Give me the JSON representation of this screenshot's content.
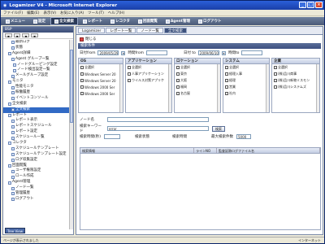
{
  "window": {
    "title": "Logamizer V4 - Microsoft Internet Explorer"
  },
  "menu": [
    "ファイル(F)",
    "編集(E)",
    "表示(V)",
    "お気に入り(A)",
    "ツール(T)",
    "ヘルプ(H)"
  ],
  "appbar": [
    "メニュー",
    "設定",
    "全文検索",
    "レポート",
    "レコクタ",
    "回面閲覧",
    "Agent管理",
    "ログアウト"
  ],
  "side": {
    "header": "BSP",
    "toolbar": [
      "",
      "",
      "",
      ""
    ],
    "tree": [
      "最新ログ",
      "状態",
      "Agent詳細",
      "Agent グループ一覧",
      "ノードグルーピング設定",
      "ノード検出設定一覧",
      "メールグループ設定",
      "モニタ",
      "性能モニタ",
      "稼働履歴",
      "イベントコンソール",
      "全文検索",
      "全文検索",
      "レポート",
      "レポート表示",
      "レポートスケジュール",
      "レポート設定",
      "スケジュール一覧",
      "コレクタ",
      "スケジュールテンプレート",
      "スケジュールテンプレート設定",
      "ログ収集設定",
      "回面閲覧",
      "ユーザ権限設定",
      "ロール作成",
      "Agent管理",
      "ノード一覧",
      "管理履歴",
      "ログアウト"
    ],
    "selected": 12,
    "tree_view": "Tree View"
  },
  "tabs": [
    "Logamizer",
    "レポート一覧",
    "ノード一覧",
    "全文検索"
  ],
  "close_label": "閉じる",
  "search": {
    "section_title": "検索条件",
    "from_label": "日付from",
    "from_date": "2009/05/29",
    "time_from_label": "時間from",
    "time_from": "",
    "to_label": "日付 to",
    "to_date": "2009/06/10",
    "time_to_label": "時間to",
    "time_to": ""
  },
  "boxes": [
    {
      "title": "OS",
      "items": [
        "全選択",
        "Windows Server 20",
        "Windows Server 20",
        "Windows 2000 Ser",
        "Windows 2000 Ser"
      ]
    },
    {
      "title": "アプリケーション",
      "items": [
        "全選択",
        "人事アプリケーション",
        "ウイルス対策アプリケ"
      ]
    },
    {
      "title": "ロケーション",
      "items": [
        "全選択",
        "東京",
        "大阪",
        "福岡",
        "名古屋"
      ]
    },
    {
      "title": "システム",
      "items": [
        "全選択",
        "経理入事",
        "経理",
        "営業",
        "社内"
      ]
    },
    {
      "title": "企業",
      "items": [
        "全選択",
        "(株)品川商事",
        "(株)品川新物ミスモン",
        "(株)品川システムズ"
      ]
    }
  ],
  "node_label": "ノード名",
  "node_value": "",
  "keyword_label": "検索キーワード",
  "keyword_value": "error",
  "search_button": "検索",
  "row3": {
    "time_label": "検索時間(秒)",
    "status_label": "検索状態",
    "time2_label": "検索時間",
    "max_label": "最大検索件数",
    "max_value": "5000"
  },
  "result_headers": [
    "検索情報",
    "ラインNO",
    "監査証跡ログファイル名"
  ],
  "status": {
    "left": "ページが表示されました",
    "right": "インターネット"
  }
}
